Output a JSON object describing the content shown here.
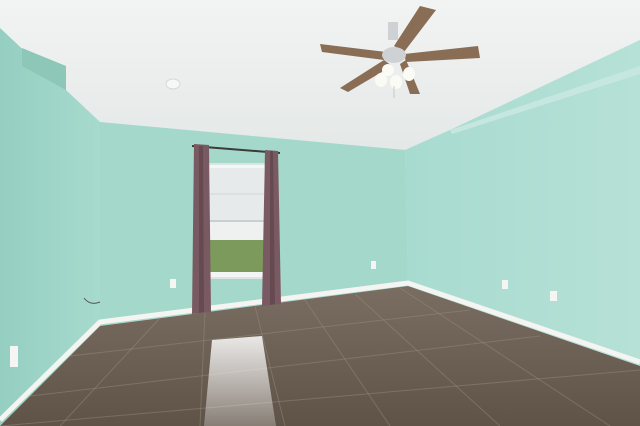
{
  "scene": {
    "kind": "empty bedroom interior photo",
    "watermark_text": "",
    "colors": {
      "wall_left": "#9fd6c9",
      "wall_back": "#a5d9cc",
      "wall_right": "#b0ddd2",
      "ceiling": "#eef1f0",
      "floor_base": "#6e6155",
      "baseboard": "#f3f3f1",
      "curtain": "#7a5a62",
      "window_light": "#e8eced",
      "fan_blade": "#8a6d55",
      "fan_body": "#cfd2d4"
    },
    "objects": [
      "ceiling-fan",
      "window",
      "curtains",
      "tile-floor",
      "baseboards",
      "wall-outlets",
      "smoke-detector"
    ]
  }
}
